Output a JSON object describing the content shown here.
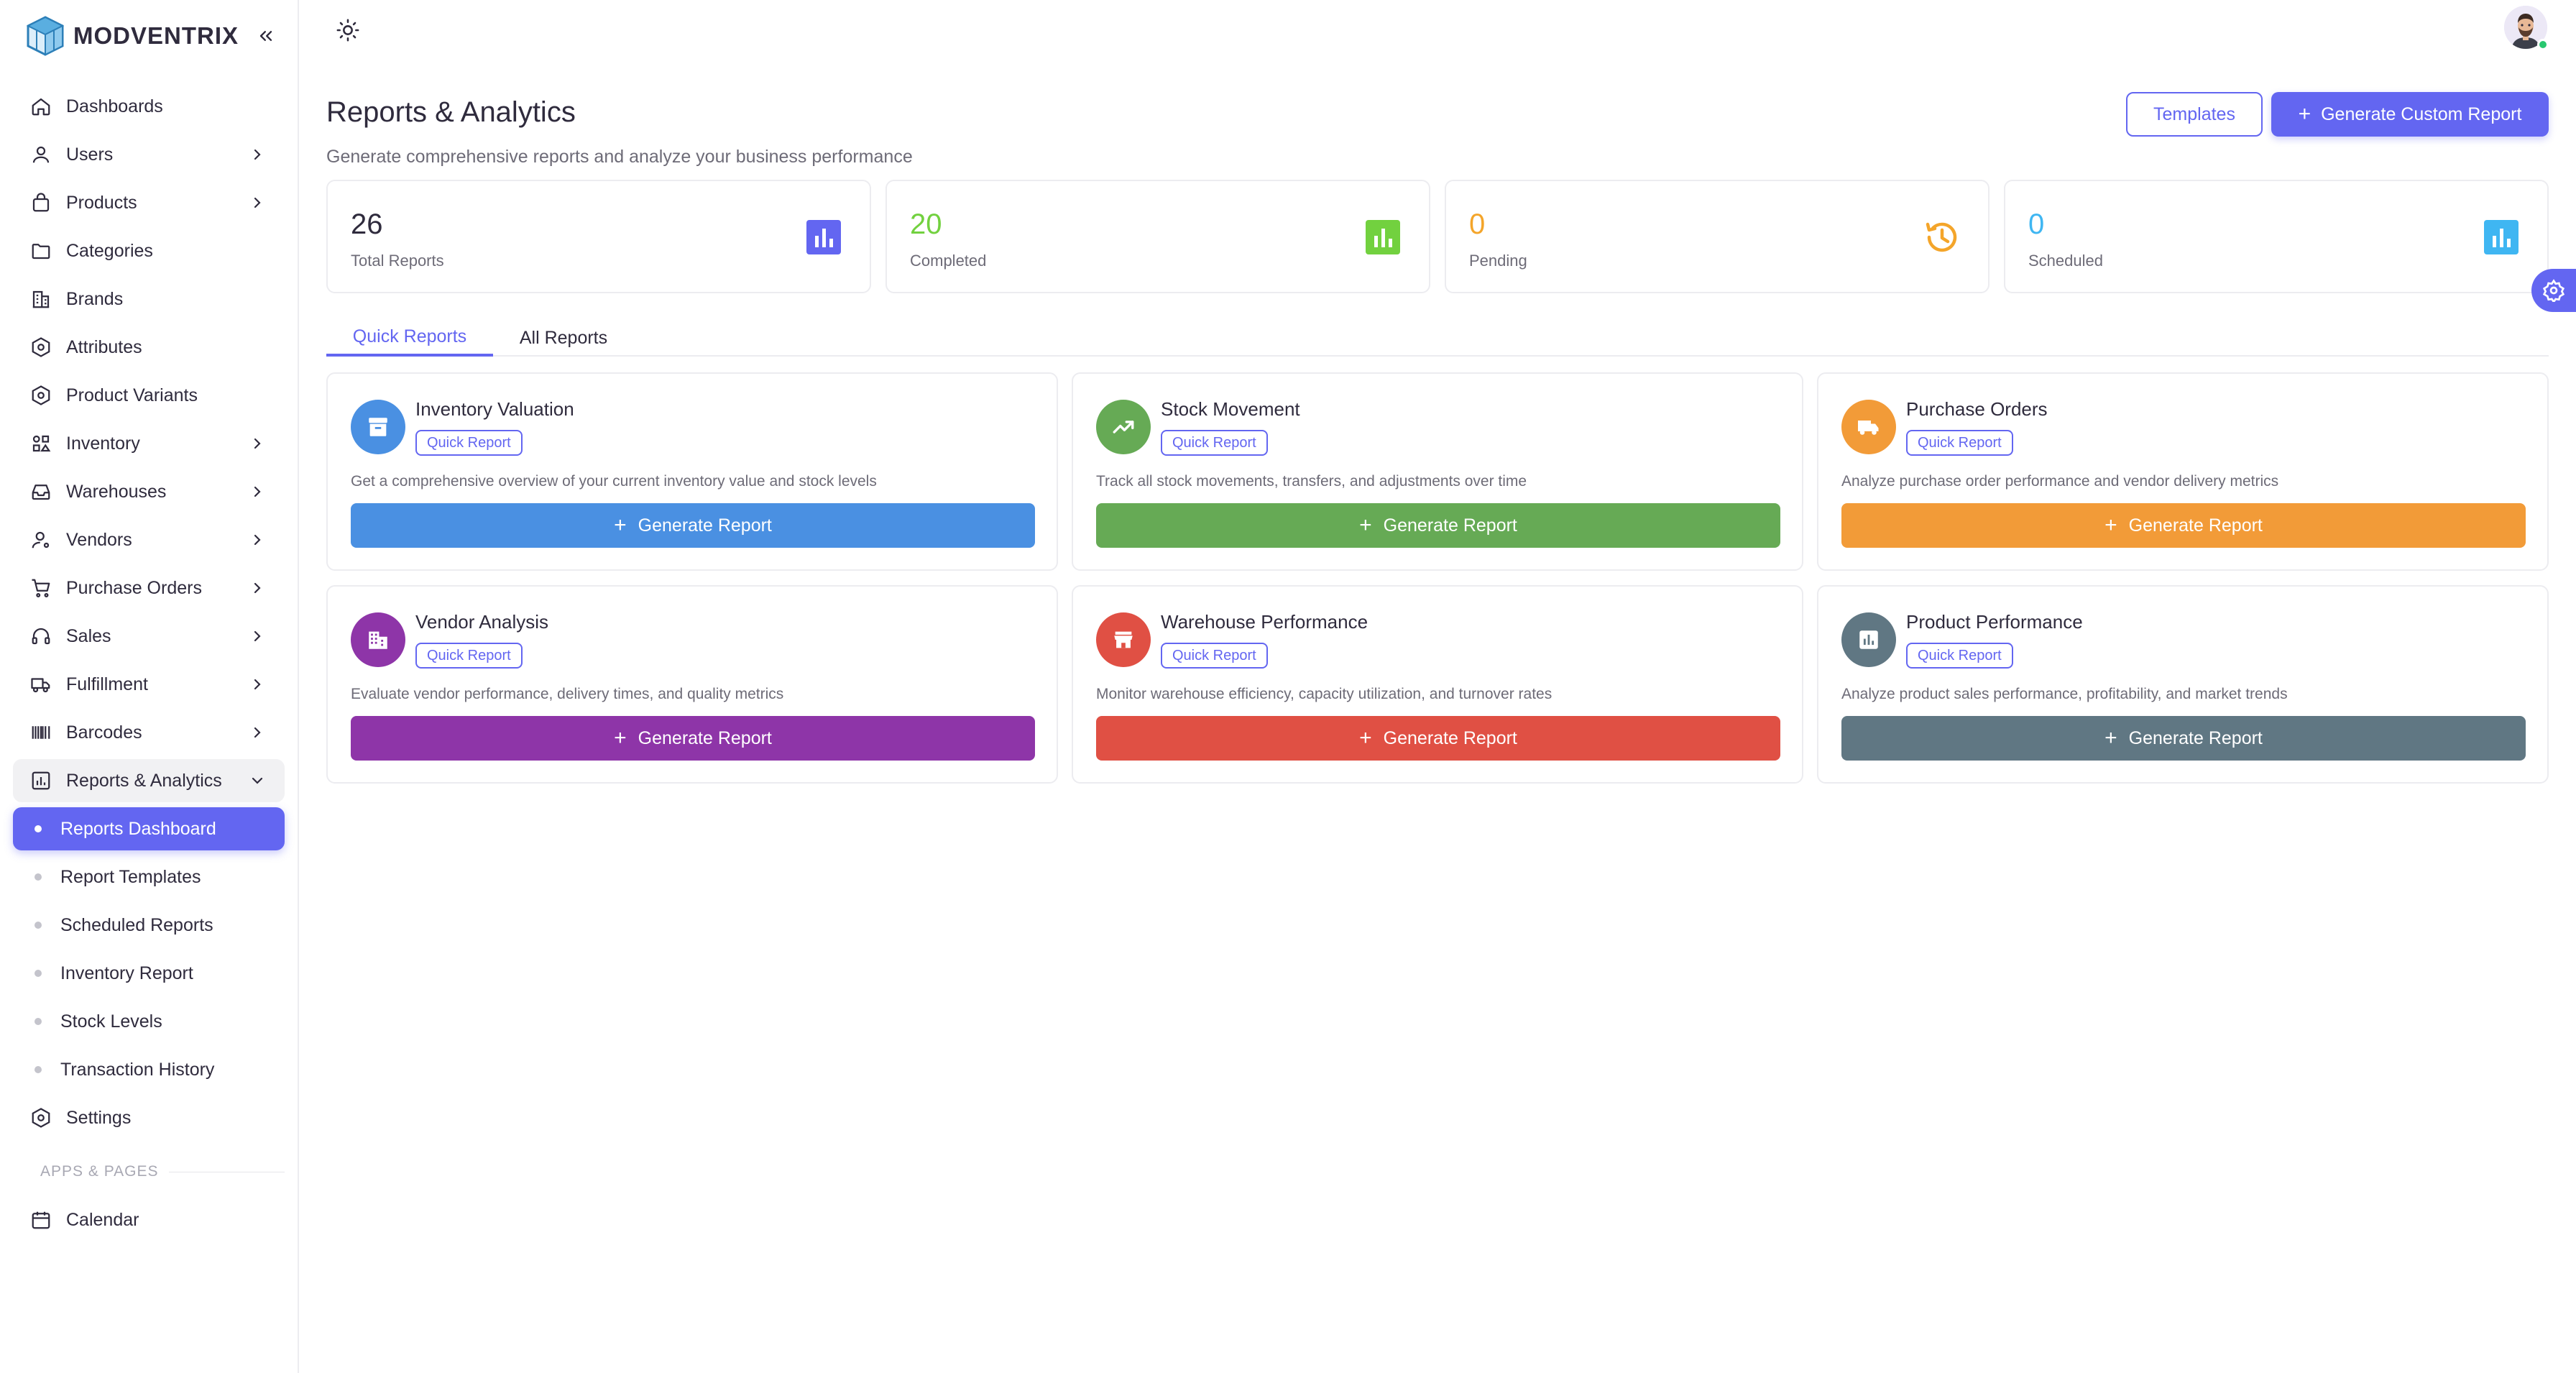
{
  "brand": {
    "name": "MODVENTRIX"
  },
  "sidebar": {
    "items": [
      {
        "label": "Dashboards",
        "icon": "home-icon",
        "chevron": false
      },
      {
        "label": "Users",
        "icon": "user-icon",
        "chevron": true
      },
      {
        "label": "Products",
        "icon": "shopping-bag-icon",
        "chevron": true
      },
      {
        "label": "Categories",
        "icon": "folder-icon",
        "chevron": false
      },
      {
        "label": "Brands",
        "icon": "building-icon",
        "chevron": false
      },
      {
        "label": "Attributes",
        "icon": "hexagon-settings-icon",
        "chevron": false
      },
      {
        "label": "Product Variants",
        "icon": "hexagon-settings-icon",
        "chevron": false
      },
      {
        "label": "Inventory",
        "icon": "shapes-icon",
        "chevron": true
      },
      {
        "label": "Warehouses",
        "icon": "inbox-icon",
        "chevron": true
      },
      {
        "label": "Vendors",
        "icon": "user-pin-icon",
        "chevron": true
      },
      {
        "label": "Purchase Orders",
        "icon": "shopping-cart-icon",
        "chevron": true
      },
      {
        "label": "Sales",
        "icon": "headphones-icon",
        "chevron": true
      },
      {
        "label": "Fulfillment",
        "icon": "truck-icon",
        "chevron": true
      },
      {
        "label": "Barcodes",
        "icon": "barcode-icon",
        "chevron": true
      },
      {
        "label": "Reports & Analytics",
        "icon": "chart-icon",
        "chevron": true
      }
    ],
    "sub_items": [
      {
        "label": "Reports Dashboard"
      },
      {
        "label": "Report Templates"
      },
      {
        "label": "Scheduled Reports"
      },
      {
        "label": "Inventory Report"
      },
      {
        "label": "Stock Levels"
      },
      {
        "label": "Transaction History"
      }
    ],
    "settings_label": "Settings",
    "section_label": "APPS & PAGES",
    "calendar_label": "Calendar"
  },
  "header": {
    "title": "Reports & Analytics",
    "subtitle": "Generate comprehensive reports and analyze your business performance",
    "templates_button": "Templates",
    "generate_custom_button": "Generate Custom Report"
  },
  "stats": [
    {
      "value": "26",
      "label": "Total Reports",
      "color": "#6366f1",
      "icon": "bar-chart-icon"
    },
    {
      "value": "20",
      "label": "Completed",
      "color": "#72d13f",
      "icon": "bar-chart-icon"
    },
    {
      "value": "0",
      "label": "Pending",
      "color": "#f4a52a",
      "icon": "history-icon"
    },
    {
      "value": "0",
      "label": "Scheduled",
      "color": "#3fb6f2",
      "icon": "bar-chart-icon"
    }
  ],
  "tabs": [
    {
      "label": "Quick Reports",
      "active": true
    },
    {
      "label": "All Reports",
      "active": false
    }
  ],
  "reports": [
    {
      "title": "Inventory Valuation",
      "badge": "Quick Report",
      "description": "Get a comprehensive overview of your current inventory value and stock levels",
      "button": "Generate Report",
      "color": "#4a90e2",
      "icon": "archive-icon"
    },
    {
      "title": "Stock Movement",
      "badge": "Quick Report",
      "description": "Track all stock movements, transfers, and adjustments over time",
      "button": "Generate Report",
      "color": "#66aa55",
      "icon": "trending-up-icon"
    },
    {
      "title": "Purchase Orders",
      "badge": "Quick Report",
      "description": "Analyze purchase order performance and vendor delivery metrics",
      "button": "Generate Report",
      "color": "#f29b38",
      "icon": "truck-icon"
    },
    {
      "title": "Vendor Analysis",
      "badge": "Quick Report",
      "description": "Evaluate vendor performance, delivery times, and quality metrics",
      "button": "Generate Report",
      "color": "#8e35a8",
      "icon": "building-icon"
    },
    {
      "title": "Warehouse Performance",
      "badge": "Quick Report",
      "description": "Monitor warehouse efficiency, capacity utilization, and turnover rates",
      "button": "Generate Report",
      "color": "#e05044",
      "icon": "store-icon"
    },
    {
      "title": "Product Performance",
      "badge": "Quick Report",
      "description": "Analyze product sales performance, profitability, and market trends",
      "button": "Generate Report",
      "color": "#607783",
      "icon": "assessment-icon"
    }
  ]
}
